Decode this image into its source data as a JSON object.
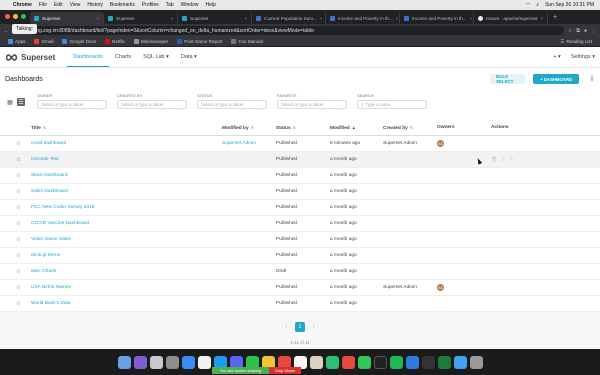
{
  "menubar": {
    "app": "Chrome",
    "items": [
      "File",
      "Edit",
      "View",
      "History",
      "Bookmarks",
      "Profiles",
      "Tab",
      "Window",
      "Help"
    ],
    "clock": "Sun Sep 26  10:31 PM"
  },
  "browser": {
    "tabs": [
      {
        "label": "Superset",
        "active": true
      },
      {
        "label": "Superset",
        "active": false
      },
      {
        "label": "Superset",
        "active": false
      },
      {
        "label": "Current Population Surv...",
        "active": false
      },
      {
        "label": "Income and Poverty in th...",
        "active": false
      },
      {
        "label": "Income and Poverty in th...",
        "active": false
      },
      {
        "label": "Issues · apache/superset",
        "active": false
      }
    ],
    "tooltip": "Talking:",
    "url": "ng.zog.im:8088/dashboard/list/?pageIndex=0&sortColumn=changed_on_delta_humanized&sortOrder=desc&viewMode=table",
    "bookmarks": [
      "Apps",
      "Gmail",
      "Google Docs",
      "Netflix",
      "Minesweeper",
      "Post-Game Report",
      "Cox Manual"
    ],
    "reading_list": "Reading List"
  },
  "nav": {
    "brand": "Superset",
    "links": [
      "Dashboards",
      "Charts",
      "SQL Lab ▾",
      "Data ▾"
    ],
    "plus": "+ ▾",
    "settings": "Settings ▾"
  },
  "page": {
    "title": "Dashboards",
    "bulk_select": "BULK SELECT",
    "add_dashboard": "+ DASHBOARD"
  },
  "filters": [
    {
      "label": "OWNER",
      "placeholder": "Select or type a value"
    },
    {
      "label": "CREATED BY",
      "placeholder": "Select or type a value"
    },
    {
      "label": "STATUS",
      "placeholder": "Select or type a value"
    },
    {
      "label": "FAVORITE",
      "placeholder": "Select or type a value"
    },
    {
      "label": "SEARCH",
      "placeholder": "Type a value"
    }
  ],
  "table": {
    "columns": {
      "title": "Title",
      "modified_by": "Modified by",
      "status": "Status",
      "modified": "Modified",
      "created_by": "Created by",
      "owners": "Owners",
      "actions": "Actions"
    },
    "rows": [
      {
        "title": "covid dashboard",
        "modified_by": "Superset Admin",
        "status": "Published",
        "modified": "9 minutes ago",
        "created_by": "Superset Admin",
        "owner": "SA"
      },
      {
        "title": "Unicode Test",
        "modified_by": "",
        "status": "Published",
        "modified": "a month ago",
        "created_by": "",
        "owner": ""
      },
      {
        "title": "Slack Dashboard",
        "modified_by": "",
        "status": "Published",
        "modified": "a month ago",
        "created_by": "",
        "owner": ""
      },
      {
        "title": "Sales Dashboard",
        "modified_by": "",
        "status": "Published",
        "modified": "a month ago",
        "created_by": "",
        "owner": ""
      },
      {
        "title": "FCC New Coder Survey 2018",
        "modified_by": "",
        "status": "Published",
        "modified": "a month ago",
        "created_by": "",
        "owner": ""
      },
      {
        "title": "COVID Vaccine Dashboard",
        "modified_by": "",
        "status": "Published",
        "modified": "a month ago",
        "created_by": "",
        "owner": ""
      },
      {
        "title": "Video Game Sales",
        "modified_by": "",
        "status": "Published",
        "modified": "a month ago",
        "created_by": "",
        "owner": ""
      },
      {
        "title": "deck.gl Demo",
        "modified_by": "",
        "status": "Published",
        "modified": "a month ago",
        "created_by": "",
        "owner": ""
      },
      {
        "title": "Misc Charts",
        "modified_by": "",
        "status": "Draft",
        "modified": "a month ago",
        "created_by": "",
        "owner": ""
      },
      {
        "title": "USA Births Names",
        "modified_by": "",
        "status": "Published",
        "modified": "a month ago",
        "created_by": "Superset Admin",
        "owner": "SA"
      },
      {
        "title": "World Bank's Data",
        "modified_by": "",
        "status": "Published",
        "modified": "a month ago",
        "created_by": "",
        "owner": ""
      }
    ]
  },
  "pagination": {
    "prev": "‹",
    "current": "1",
    "next": "›",
    "summary": "1-11 of 11"
  },
  "screen_share": {
    "message": "You are screen sharing",
    "stop": "Stop Share"
  },
  "colors": {
    "accent": "#1fa8c9",
    "accent_light": "#e3f3f8"
  }
}
